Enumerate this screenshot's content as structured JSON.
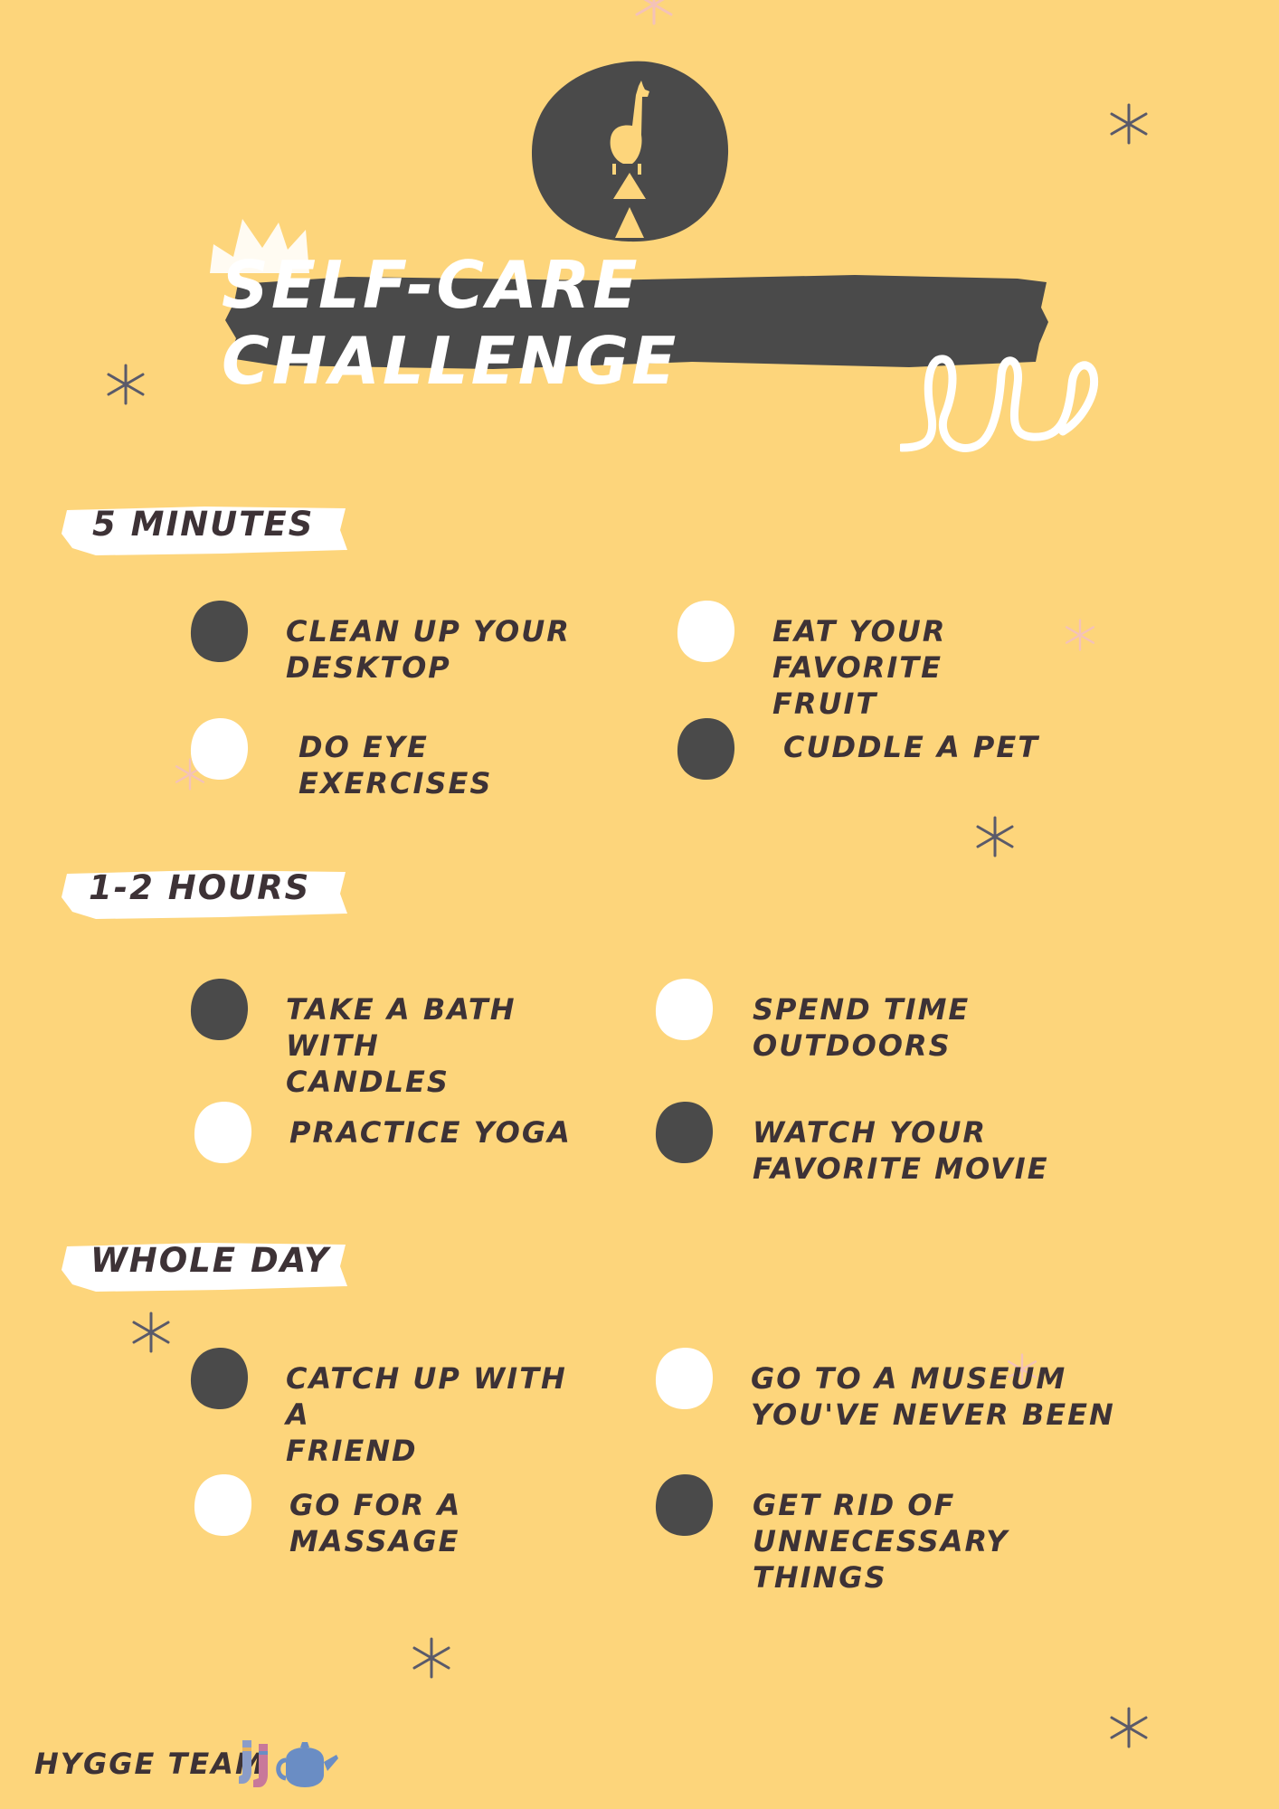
{
  "title": "SELF-CARE CHALLENGE",
  "colors": {
    "background": "#fdd57b",
    "dark": "#4a4a4a",
    "text": "#3d3236",
    "white": "#ffffff",
    "logo_accent": "#fdd57b",
    "teapot": "#6a8dc4"
  },
  "sections": [
    {
      "heading": "5 MINUTES",
      "items": [
        {
          "label": "CLEAN UP YOUR\nDESKTOP",
          "dot": "dark"
        },
        {
          "label": "EAT YOUR FAVORITE\nFRUIT",
          "dot": "white"
        },
        {
          "label": "DO EYE EXERCISES",
          "dot": "white"
        },
        {
          "label": "CUDDLE A PET",
          "dot": "dark"
        }
      ]
    },
    {
      "heading": "1-2 HOURS",
      "items": [
        {
          "label": "TAKE A BATH WITH\nCANDLES",
          "dot": "dark"
        },
        {
          "label": "SPEND TIME\nOUTDOORS",
          "dot": "white"
        },
        {
          "label": "PRACTICE YOGA",
          "dot": "white"
        },
        {
          "label": "WATCH YOUR\nFAVORITE MOVIE",
          "dot": "dark"
        }
      ]
    },
    {
      "heading": "WHOLE DAY",
      "items": [
        {
          "label": "CATCH UP WITH A\nFRIEND",
          "dot": "dark"
        },
        {
          "label": "GO TO A MUSEUM\nYOU'VE NEVER BEEN",
          "dot": "white"
        },
        {
          "label": "GO FOR A MASSAGE",
          "dot": "white"
        },
        {
          "label": "GET RID OF\nUNNECESSARY THINGS",
          "dot": "dark"
        }
      ]
    }
  ],
  "footer": "HYGGE TEAM",
  "icons": [
    "llama-hourglass-logo-icon",
    "sparkle-star-icon",
    "socks-icon",
    "teapot-icon"
  ]
}
